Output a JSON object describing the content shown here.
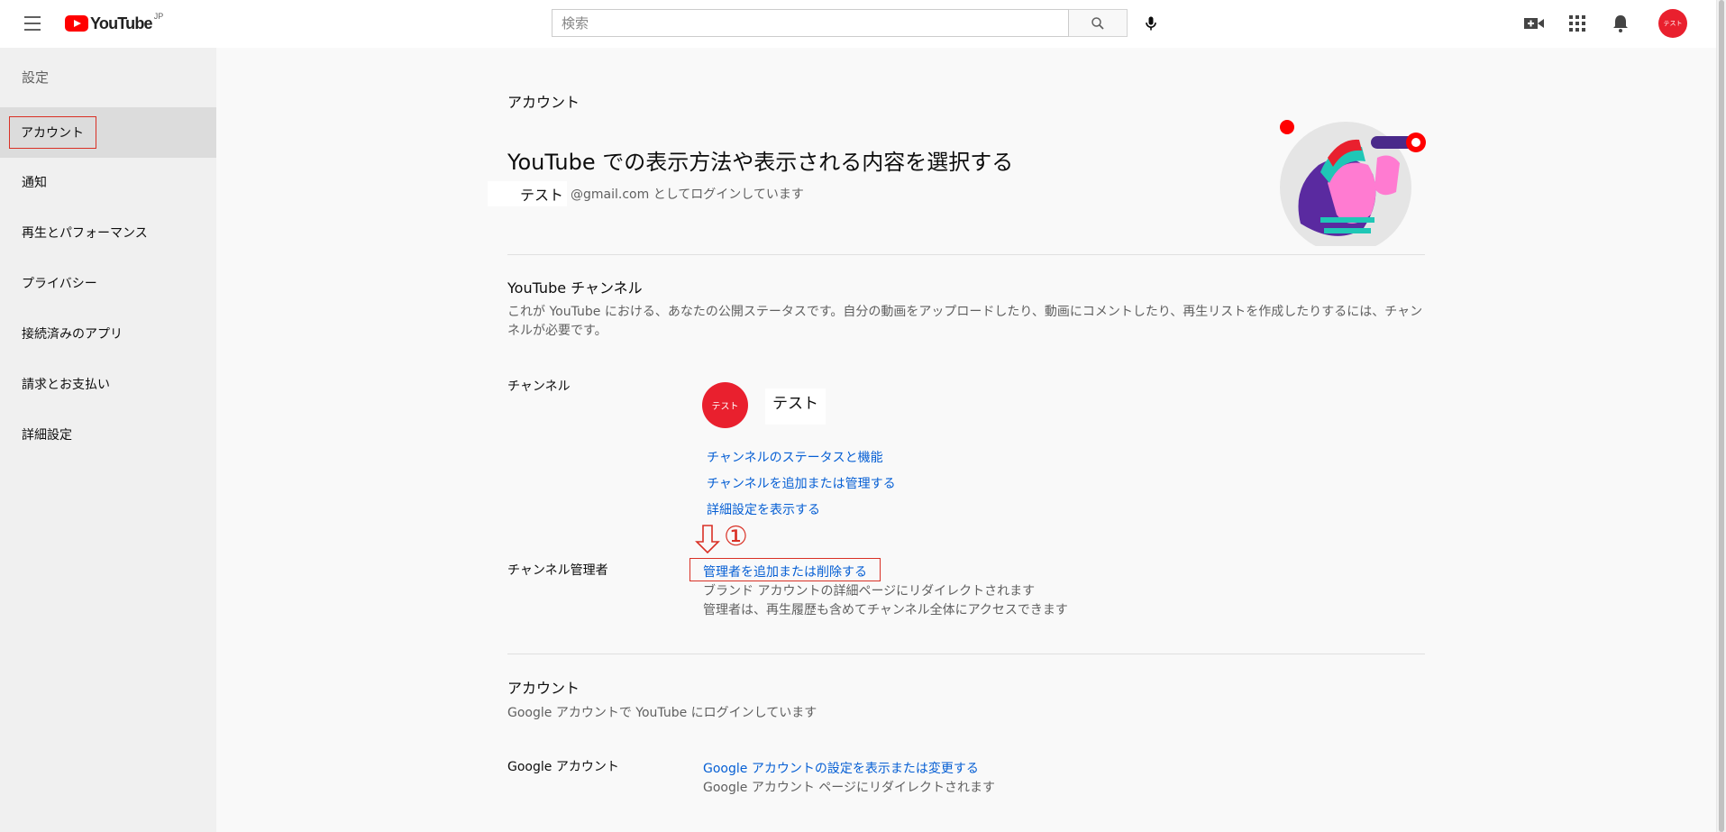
{
  "header": {
    "logo_text": "YouTube",
    "logo_region": "JP",
    "search_placeholder": "検索",
    "avatar_text": "テスト",
    "icons": [
      "menu-icon",
      "search-icon",
      "mic-icon",
      "create-video-icon",
      "apps-grid-icon",
      "notifications-bell-icon"
    ]
  },
  "sidebar": {
    "title": "設定",
    "items": [
      {
        "label": "アカウント",
        "active": true
      },
      {
        "label": "通知"
      },
      {
        "label": "再生とパフォーマンス"
      },
      {
        "label": "プライバシー"
      },
      {
        "label": "接続済みのアプリ"
      },
      {
        "label": "請求とお支払い"
      },
      {
        "label": "詳細設定"
      }
    ]
  },
  "main": {
    "section_label": "アカウント",
    "title": "YouTube での表示方法や表示される内容を選択する",
    "login_name": "テスト",
    "login_suffix": "@gmail.com としてログインしています",
    "channel_section": {
      "heading": "YouTube チャンネル",
      "description": "これが YouTube における、あなたの公開ステータスです。自分の動画をアップロードしたり、動画にコメントしたり、再生リストを作成したりするには、チャンネルが必要です。",
      "channel_label": "チャンネル",
      "channel_avatar_text": "テスト",
      "channel_name": "テスト",
      "links": [
        "チャンネルのステータスと機能",
        "チャンネルを追加または管理する",
        "詳細設定を表示する"
      ],
      "admin_label": "チャンネル管理者",
      "admin_annotation": "①",
      "admin_link": "管理者を追加または削除する",
      "admin_note_1": "ブランド アカウントの詳細ページにリダイレクトされます",
      "admin_note_2": "管理者は、再生履歴も含めてチャンネル全体にアクセスできます"
    },
    "account_section": {
      "heading": "アカウント",
      "description": "Google アカウントで YouTube にログインしています",
      "google_label": "Google アカウント",
      "google_link": "Google アカウントの設定を表示または変更する",
      "google_note": "Google アカウント ページにリダイレクトされます"
    }
  },
  "colors": {
    "accent_red": "#ff0000",
    "avatar_red": "#e9202e",
    "link_blue": "#065fd4",
    "highlight_red": "#d93025"
  }
}
